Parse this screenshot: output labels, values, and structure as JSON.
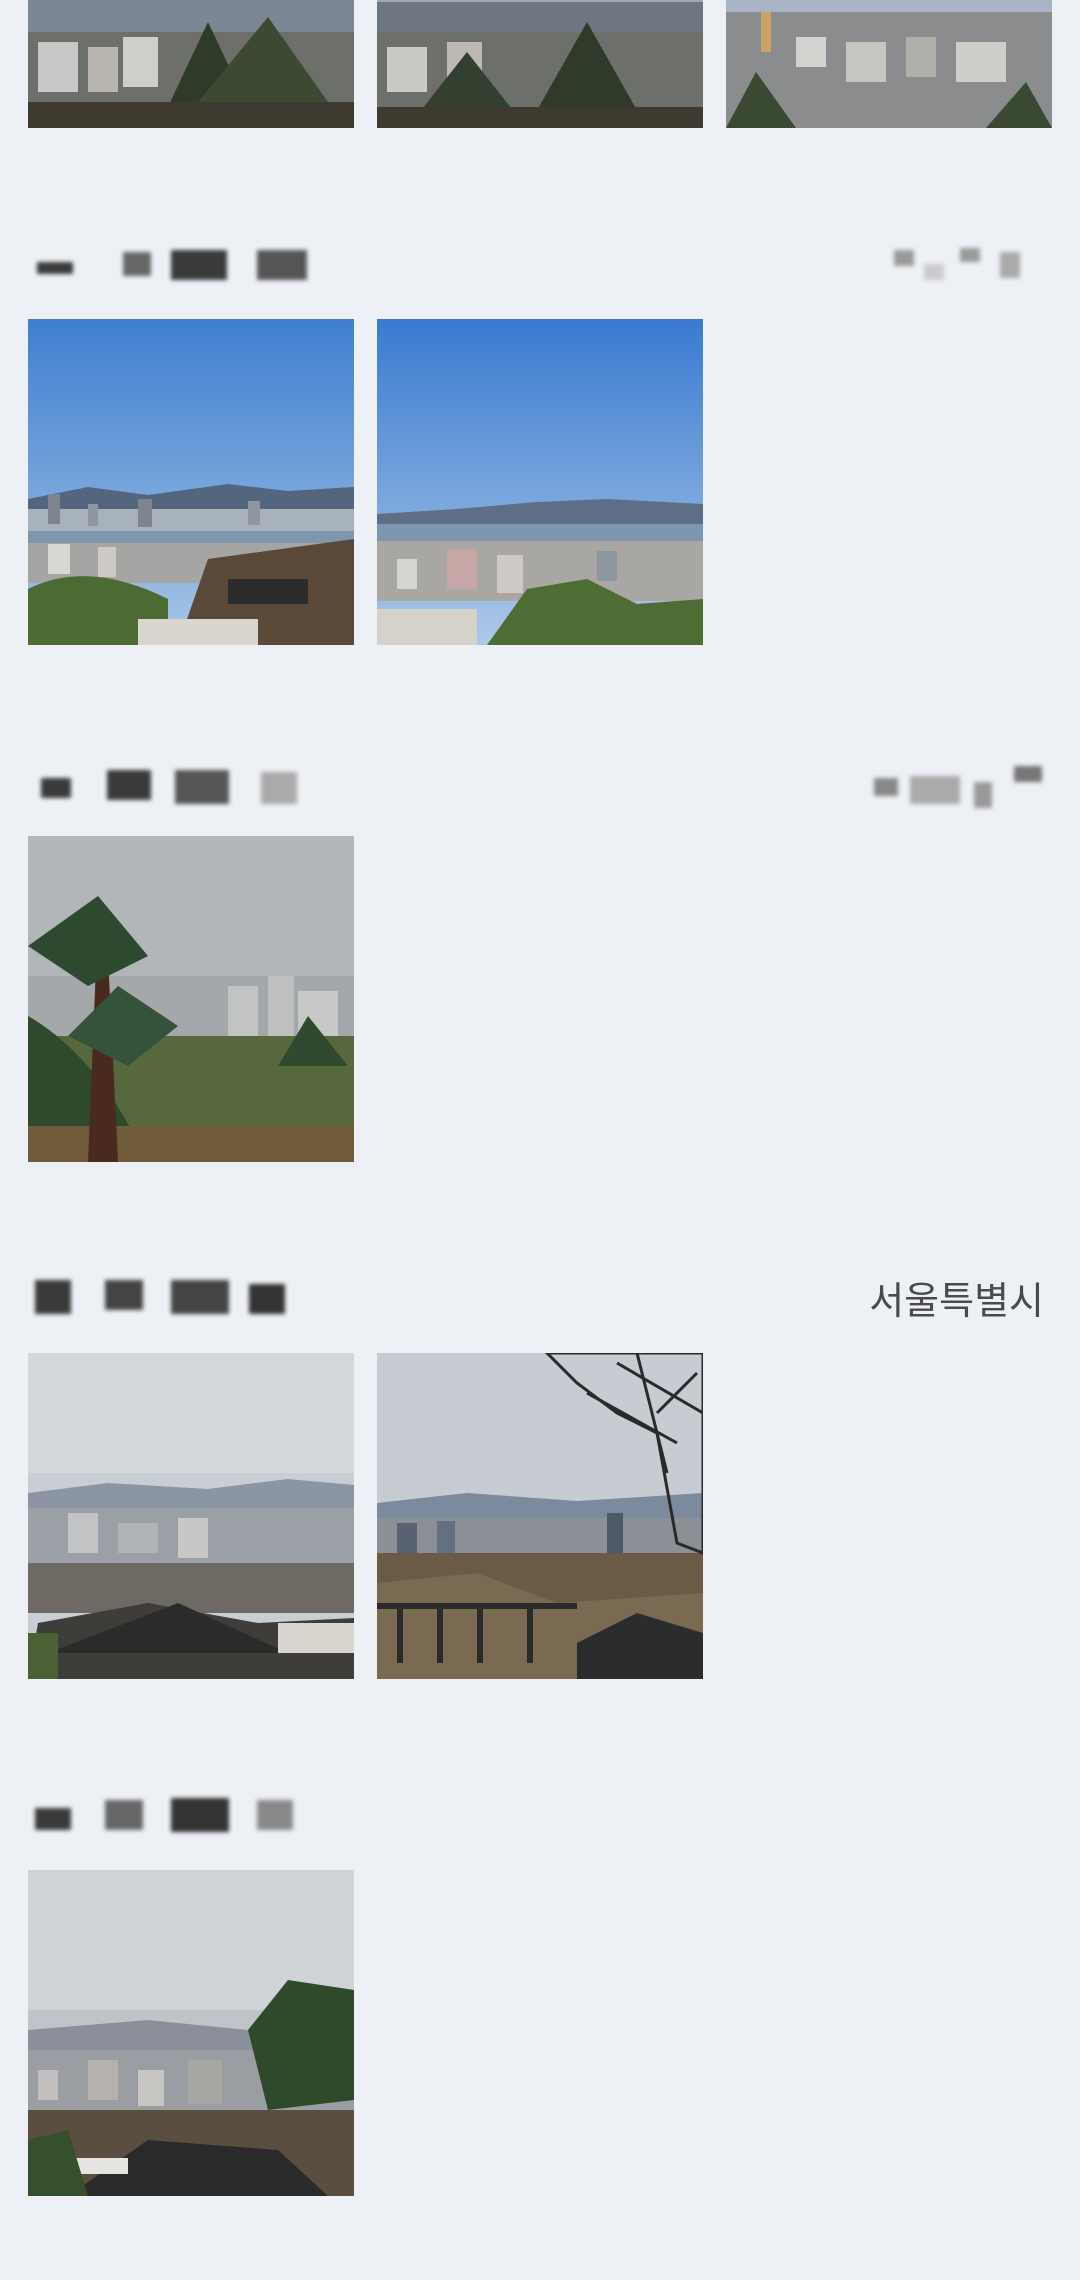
{
  "screen": "photo-timeline",
  "sections": [
    {
      "date_label": "",
      "location": "",
      "photos": [
        "city-skyline-pine",
        "city-skyline-pine-2",
        "city-skyline-hazy"
      ]
    },
    {
      "date_label": "",
      "location": "",
      "photos": [
        "river-view-blue-sky",
        "river-view-blue-sky-2"
      ]
    },
    {
      "date_label": "",
      "location": "",
      "photos": [
        "pine-tree-fog"
      ]
    },
    {
      "date_label": "",
      "location": "서울특별시",
      "photos": [
        "temple-roof-city",
        "tree-branches-stairs"
      ]
    },
    {
      "date_label": "",
      "location": "",
      "photos": [
        "temple-roof-hazy-city"
      ]
    }
  ],
  "colors": {
    "background": "#edf0f4",
    "text": "#4a4a4a"
  }
}
